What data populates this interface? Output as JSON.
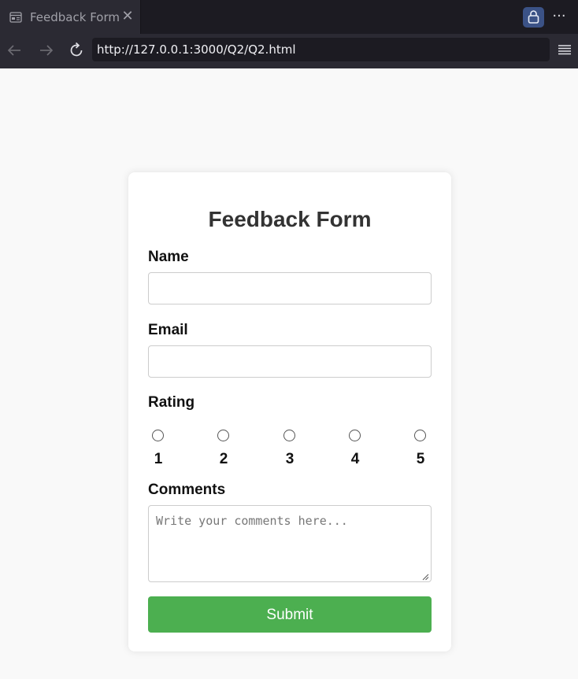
{
  "browser": {
    "tab_title": "Feedback Form",
    "tab_close": "✕",
    "url": "http://127.0.0.1:3000/Q2/Q2.html",
    "menu_dots": "···",
    "icons": [
      "page-icon",
      "close-icon",
      "lock-icon",
      "more-icon",
      "back-arrow-icon",
      "forward-arrow-icon",
      "reload-icon",
      "hamburger-menu-icon"
    ]
  },
  "form": {
    "title": "Feedback Form",
    "name_label": "Name",
    "name_value": "",
    "email_label": "Email",
    "email_value": "",
    "rating_label": "Rating",
    "rating_options": [
      "1",
      "2",
      "3",
      "4",
      "5"
    ],
    "rating_selected": null,
    "comments_label": "Comments",
    "comments_placeholder": "Write your comments here...",
    "comments_value": "",
    "submit_label": "Submit"
  },
  "colors": {
    "accent_submit": "#4caf50",
    "page_background": "#f9f9f9",
    "chrome_dark": "#2b2a33",
    "lock_button": "#3b5286"
  }
}
